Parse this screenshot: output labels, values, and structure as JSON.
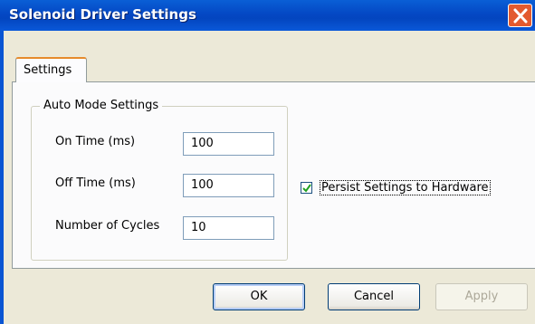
{
  "window": {
    "title": "Solenoid Driver Settings"
  },
  "tabs": [
    {
      "label": "Settings"
    }
  ],
  "auto_mode": {
    "label": "Auto Mode Settings",
    "on_time": {
      "label": "On Time (ms)",
      "value": "100"
    },
    "off_time": {
      "label": "Off Time (ms)",
      "value": "100"
    },
    "cycles": {
      "label": "Number of Cycles",
      "value": "10"
    }
  },
  "persist": {
    "label": "Persist Settings to Hardware",
    "checked": true
  },
  "buttons": {
    "ok": "OK",
    "cancel": "Cancel",
    "apply": "Apply",
    "apply_disabled": true
  },
  "colors": {
    "titlebar": "#0a5fd6",
    "close_button": "#e35a2f",
    "dialog_bg": "#ece9d8"
  }
}
